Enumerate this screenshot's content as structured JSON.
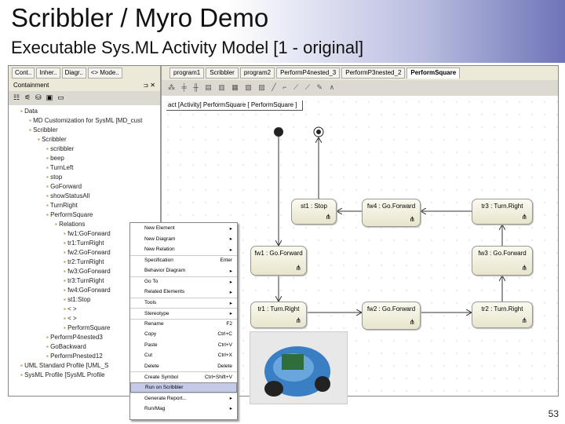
{
  "slide": {
    "title": "Scribbler / Myro Demo",
    "subtitle": "Executable Sys.ML Activity Model [1 - original]",
    "page": "53"
  },
  "left_panel": {
    "tabs": [
      "Cont..",
      "Inher..",
      "Diagr..",
      "<> Mode.."
    ],
    "title": "Containment",
    "tree": [
      "Data",
      "MD Customization for SysML [MD_cust",
      "Scribbler",
      "Scribbler",
      "scribbler",
      "beep",
      "TurnLeft",
      "stop",
      "GoForward",
      "showStatusAll",
      "TurnRight",
      "PerformSquare",
      "Relations",
      "fw1:GoForward",
      "tr1:TurnRight",
      "fw2:GoForward",
      "tr2:TurnRight",
      "fw3:GoForward",
      "tr3:TurnRight",
      "fw4:GoForward",
      "st1:Stop",
      "< >",
      "< >",
      "PerformSquare",
      "PerformP4nested3",
      "GoBackward",
      "PerformPnested12",
      "UML Standard Profile [UML_S",
      "SysML Profile [SysML Profile"
    ]
  },
  "editor": {
    "tabs": [
      "program1",
      "Scribbler",
      "program2",
      "PerformP4nested_3",
      "PerformP3nested_2",
      "PerformSquare"
    ],
    "frame_label": "act [Activity] PerformSquare [ PerformSquare ]",
    "nodes": {
      "st1": "st1 : Stop",
      "fw4": "fw4 : Go.Forward",
      "tr3": "tr3 : Turn.Right",
      "fw1": "fw1 : Go.Forward",
      "fw3": "fw3 : Go.Forward",
      "tr1": "tr1 : Turn.Right",
      "fw2": "fw2 : Go.Forward",
      "tr2": "tr2 : Turn.Right"
    }
  },
  "context_menu": [
    {
      "label": "New Element",
      "shortcut": "",
      "sub": true
    },
    {
      "label": "New Diagram",
      "shortcut": "",
      "sub": true
    },
    {
      "label": "New Relation",
      "shortcut": "",
      "sub": true
    },
    {
      "label": "Specification",
      "shortcut": "Enter",
      "sub": false,
      "sep": true
    },
    {
      "label": "Behavior Diagram",
      "shortcut": "",
      "sub": true
    },
    {
      "label": "Go To",
      "shortcut": "",
      "sub": true,
      "sep": true
    },
    {
      "label": "Related Elements",
      "shortcut": "",
      "sub": true
    },
    {
      "label": "Tools",
      "shortcut": "",
      "sub": true,
      "sep": true
    },
    {
      "label": "Stereotype",
      "shortcut": "",
      "sub": true,
      "sep": true
    },
    {
      "label": "Rename",
      "shortcut": "F2",
      "sub": false,
      "sep": true
    },
    {
      "label": "Copy",
      "shortcut": "Ctrl+C",
      "sub": false
    },
    {
      "label": "Paste",
      "shortcut": "Ctrl+V",
      "sub": false
    },
    {
      "label": "Cut",
      "shortcut": "Ctrl+X",
      "sub": false
    },
    {
      "label": "Delete",
      "shortcut": "Delete",
      "sub": false
    },
    {
      "label": "Create Symbol",
      "shortcut": "Ctrl+Shift+V",
      "sub": false,
      "sep": true
    },
    {
      "label": "Run on Scribbler",
      "shortcut": "",
      "sub": false,
      "sep": true,
      "hl": true
    },
    {
      "label": "Generate Report...",
      "shortcut": "",
      "sub": true,
      "sep": true
    },
    {
      "label": "Run/Mag",
      "shortcut": "",
      "sub": true
    }
  ]
}
